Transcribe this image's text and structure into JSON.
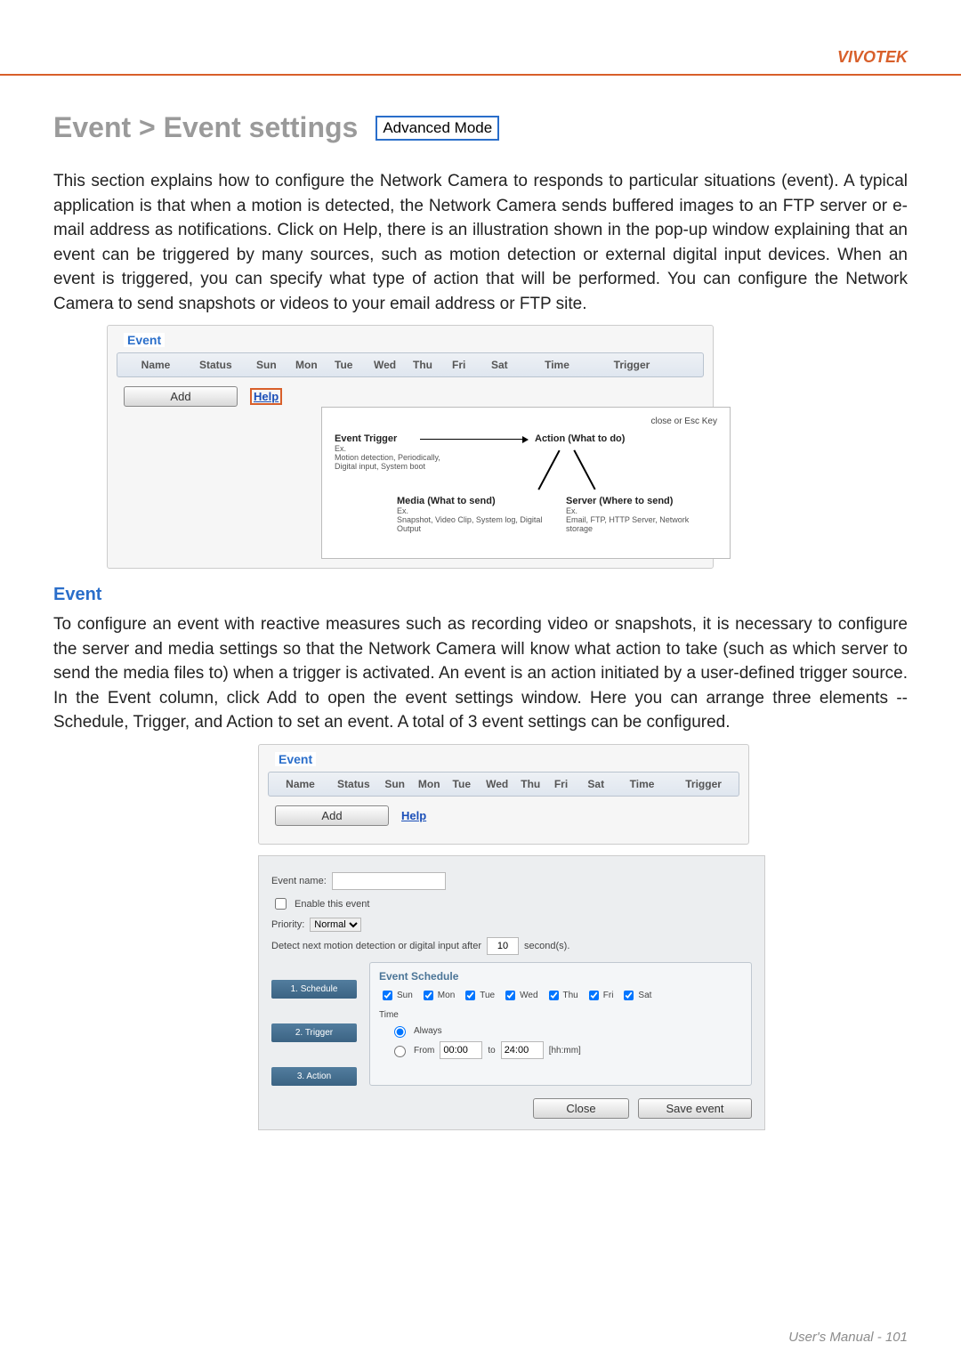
{
  "header": {
    "brand": "VIVOTEK"
  },
  "title": "Event > Event settings",
  "advanced_label": "Advanced Mode",
  "intro_paragraph": "This section explains how to configure the Network Camera to responds to particular situations (event). A typical application is that when a motion is detected, the Network Camera sends buffered images to an FTP server or e-mail address as notifications. Click on Help, there is an illustration shown in the pop-up window explaining that an event can be triggered by many sources, such as motion detection or external digital input devices. When an event is triggered, you can specify what type of action that will be performed. You can configure the Network Camera to send snapshots or videos to your email address or FTP site.",
  "event_panel": {
    "legend_title": "Event",
    "columns": [
      "Name",
      "Status",
      "Sun",
      "Mon",
      "Tue",
      "Wed",
      "Thu",
      "Fri",
      "Sat",
      "Time",
      "Trigger"
    ],
    "add_label": "Add",
    "help_label": "Help",
    "popup": {
      "close_text": "close or Esc Key",
      "trigger_title": "Event Trigger",
      "trigger_ex_label": "Ex.",
      "trigger_ex": "Motion detection, Periodically, Digital input, System boot",
      "action_title": "Action (What to do)",
      "media_title": "Media (What to send)",
      "media_ex_label": "Ex.",
      "media_ex": "Snapshot, Video Clip, System log, Digital Output",
      "server_title": "Server (Where to send)",
      "server_ex_label": "Ex.",
      "server_ex": "Email, FTP, HTTP Server, Network storage"
    }
  },
  "section_event_heading": "Event",
  "event_paragraph": "To configure an event with reactive measures such as recording video or snapshots, it is necessary to configure the server and media settings so that the Network Camera will know what action to take (such as which server to send the media files to) when a trigger is activated. An event is an action initiated by a user-defined trigger source. In the Event  column, click Add to open the event settings window. Here you can arrange three elements -- Schedule, Trigger, and Action to set an event. A total of 3 event settings can be configured.",
  "settings_form": {
    "event_name_label": "Event name:",
    "event_name_value": "",
    "enable_label": "Enable this event",
    "priority_label": "Priority:",
    "priority_value": "Normal",
    "detect_label_pre": "Detect next motion detection or digital input after",
    "detect_value": "10",
    "detect_label_post": "second(s).",
    "steps": [
      "1. Schedule",
      "2. Trigger",
      "3. Action"
    ],
    "schedule": {
      "title": "Event Schedule",
      "days": [
        "Sun",
        "Mon",
        "Tue",
        "Wed",
        "Thu",
        "Fri",
        "Sat"
      ],
      "time_label": "Time",
      "always_label": "Always",
      "from_label": "From",
      "from_value": "00:00",
      "to_label": "to",
      "to_value": "24:00",
      "hhmm_label": "[hh:mm]"
    },
    "buttons": {
      "close": "Close",
      "save": "Save event"
    }
  },
  "footer": "User's Manual - 101"
}
